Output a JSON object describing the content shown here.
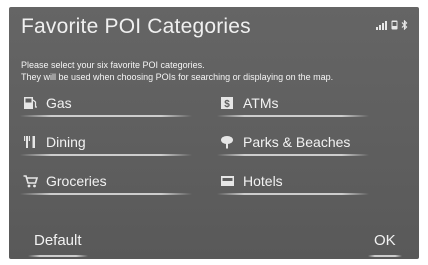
{
  "header": {
    "title": "Favorite POI Categories",
    "status_icons": [
      "signal-bars-icon",
      "phone-icon",
      "bluetooth-icon"
    ]
  },
  "instructions": {
    "line1": "Please select your six favorite POI categories.",
    "line2": "They will be used when choosing POIs for searching or displaying on the map."
  },
  "categories": [
    {
      "label": "Gas",
      "icon": "gas-pump-icon"
    },
    {
      "label": "ATMs",
      "icon": "atm-icon"
    },
    {
      "label": "Dining",
      "icon": "fork-knife-icon"
    },
    {
      "label": "Parks & Beaches",
      "icon": "tree-icon"
    },
    {
      "label": "Groceries",
      "icon": "shopping-cart-icon"
    },
    {
      "label": "Hotels",
      "icon": "bed-icon"
    }
  ],
  "footer": {
    "default_label": "Default",
    "ok_label": "OK"
  }
}
